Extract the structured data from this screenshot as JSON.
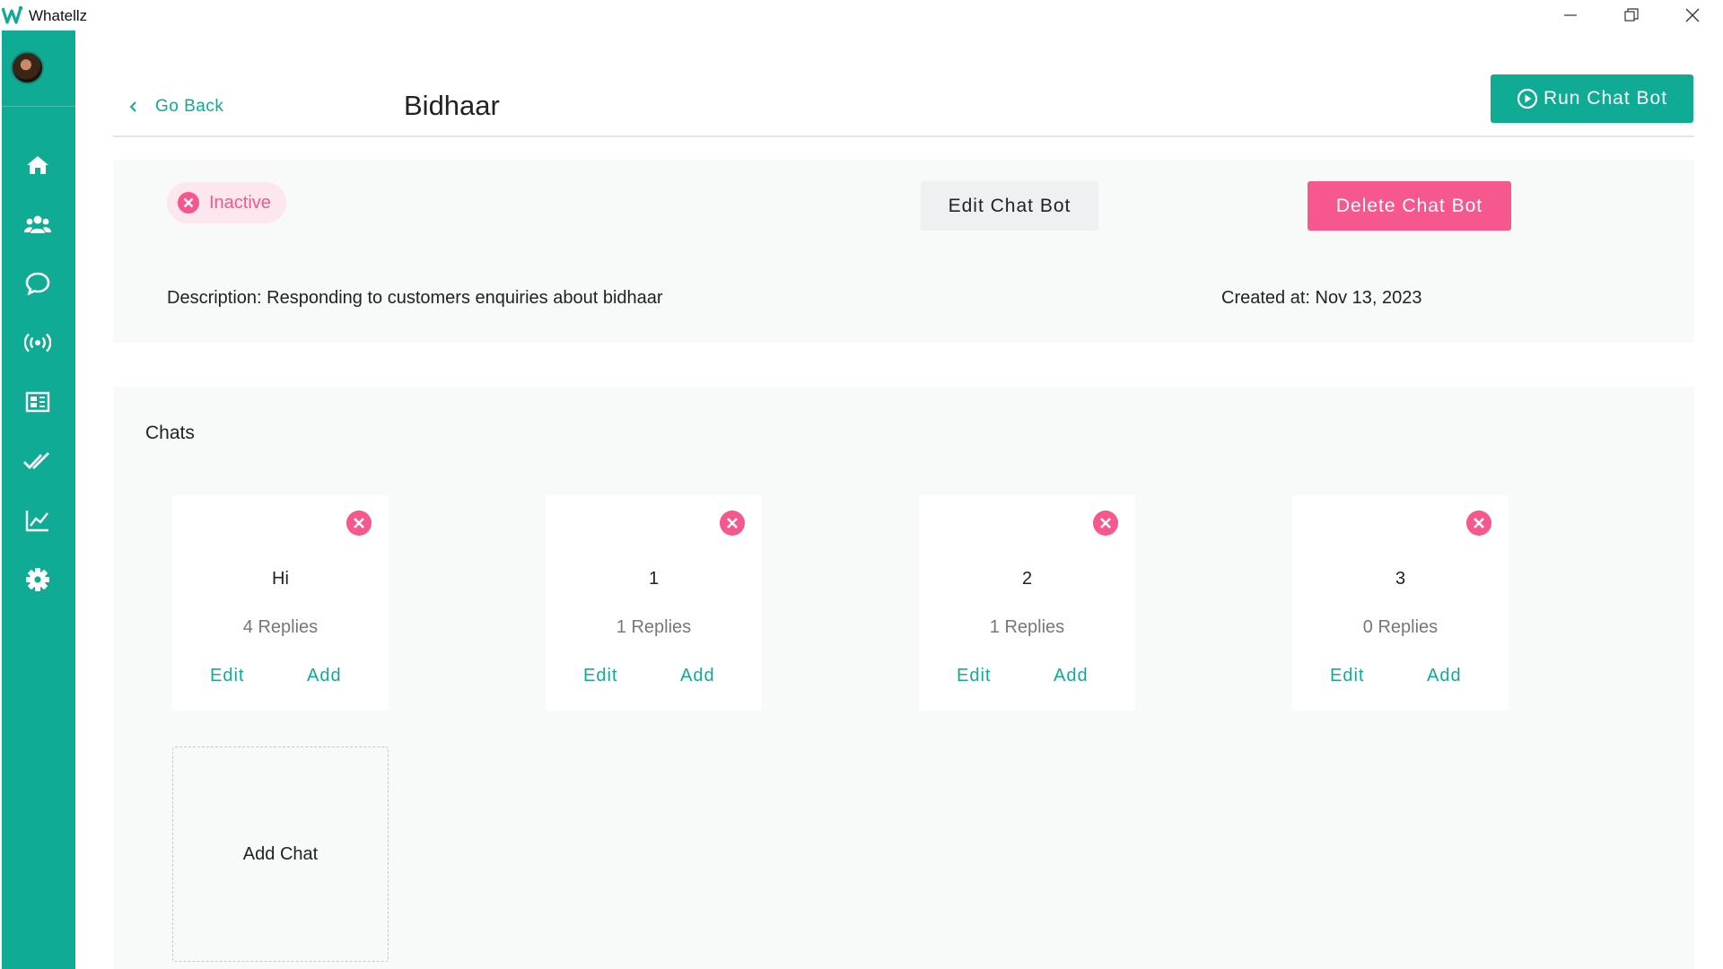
{
  "app": {
    "title": "Whatellz"
  },
  "window": {
    "minimize_icon": "minimize-icon",
    "maximize_icon": "restore-icon",
    "close_icon": "close-icon"
  },
  "sidebar": {
    "avatar": "user-avatar",
    "items": [
      {
        "icon": "home-icon"
      },
      {
        "icon": "users-icon"
      },
      {
        "icon": "chat-bubble-icon"
      },
      {
        "icon": "broadcast-icon"
      },
      {
        "icon": "templates-icon"
      },
      {
        "icon": "double-check-icon"
      },
      {
        "icon": "analytics-icon"
      },
      {
        "icon": "settings-icon"
      }
    ]
  },
  "header": {
    "back_label": "Go Back",
    "title": "Bidhaar",
    "run_label": "Run Chat Bot"
  },
  "bot": {
    "status": "Inactive",
    "edit_label": "Edit Chat Bot",
    "delete_label": "Delete Chat Bot",
    "description": "Description: Responding to customers enquiries about bidhaar",
    "created": "Created at: Nov 13, 2023"
  },
  "chats": {
    "heading": "Chats",
    "items": [
      {
        "name": "Hi",
        "replies": "4 Replies",
        "edit": "Edit",
        "add": "Add"
      },
      {
        "name": "1",
        "replies": "1 Replies",
        "edit": "Edit",
        "add": "Add"
      },
      {
        "name": "2",
        "replies": "1 Replies",
        "edit": "Edit",
        "add": "Add"
      },
      {
        "name": "3",
        "replies": "0 Replies",
        "edit": "Edit",
        "add": "Add"
      }
    ],
    "add_chat_label": "Add Chat"
  },
  "colors": {
    "accent": "#0fab95",
    "danger": "#f6578e",
    "inactive_bg": "#fde7ef",
    "panel_bg": "#f8f9f9"
  }
}
